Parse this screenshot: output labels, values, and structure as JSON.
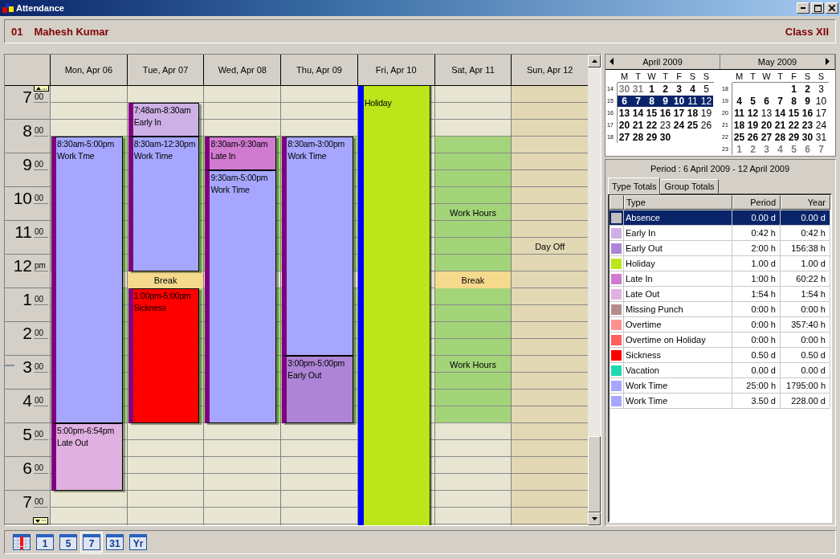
{
  "window": {
    "title": "Attendance"
  },
  "person": {
    "number": "01",
    "name": "Mahesh Kumar",
    "class": "Class XII"
  },
  "time_labels": [
    {
      "hour": "7",
      "suffix": "00"
    },
    {
      "hour": "8",
      "suffix": "00"
    },
    {
      "hour": "9",
      "suffix": "00"
    },
    {
      "hour": "10",
      "suffix": "00"
    },
    {
      "hour": "11",
      "suffix": "00"
    },
    {
      "hour": "12",
      "suffix": "pm"
    },
    {
      "hour": "1",
      "suffix": "00"
    },
    {
      "hour": "2",
      "suffix": "00"
    },
    {
      "hour": "3",
      "suffix": "00"
    },
    {
      "hour": "4",
      "suffix": "00"
    },
    {
      "hour": "5",
      "suffix": "00"
    },
    {
      "hour": "6",
      "suffix": "00"
    },
    {
      "hour": "7",
      "suffix": "00"
    }
  ],
  "days": [
    {
      "label": "Mon, Apr 06",
      "kind": "workday",
      "work_hours": true,
      "events": [
        {
          "kind": "timed",
          "time": "8:30am-5:00pm",
          "type": "Work Tme",
          "color": "#a6a6ff"
        },
        {
          "kind": "timed",
          "time": "5:00pm-6:54pm",
          "type": "Late Out",
          "color": "#e0b0e0"
        }
      ]
    },
    {
      "label": "Tue, Apr 07",
      "kind": "workday",
      "work_hours": true,
      "break_label": "Break",
      "events": [
        {
          "kind": "timed",
          "time": "7:48am-8:30am",
          "type": "Early In",
          "color": "#cdb0e6"
        },
        {
          "kind": "timed",
          "time": "8:30am-12:30pm",
          "type": "Work Time",
          "color": "#a6a6ff"
        },
        {
          "kind": "timed",
          "time": "1:00pm-5:00pm",
          "type": "Sickness",
          "color": "#ff0000"
        }
      ]
    },
    {
      "label": "Wed, Apr 08",
      "kind": "workday",
      "work_hours": true,
      "events": [
        {
          "kind": "timed",
          "time": "8:30am-9:30am",
          "type": "Late In",
          "color": "#d07ad0"
        },
        {
          "kind": "timed",
          "time": "9:30am-5:00pm",
          "type": "Work Time",
          "color": "#a6a6ff"
        }
      ]
    },
    {
      "label": "Thu, Apr 09",
      "kind": "workday",
      "work_hours": true,
      "events": [
        {
          "kind": "timed",
          "time": "8:30am-3:00pm",
          "type": "Work Time",
          "color": "#a6a6ff"
        },
        {
          "kind": "timed",
          "time": "3:00pm-5:00pm",
          "type": "Early Out",
          "color": "#ae84d6"
        }
      ]
    },
    {
      "label": "Fri, Apr 10",
      "kind": "workday",
      "events": [
        {
          "kind": "all_day",
          "type": "Holiday",
          "color": "#bce619"
        }
      ]
    },
    {
      "label": "Sat, Apr 11",
      "kind": "workday",
      "work_hours": true,
      "break_label": "Break",
      "hours_labels": [
        "Work Hours",
        "Work Hours"
      ]
    },
    {
      "label": "Sun, Apr 12",
      "kind": "day_off",
      "note": "Day Off"
    }
  ],
  "mini_calendar": {
    "months": [
      {
        "title": "April 2009",
        "weekdays": [
          "M",
          "T",
          "W",
          "T",
          "F",
          "S",
          "S"
        ],
        "weeks": [
          {
            "number": "14",
            "selected": false,
            "days": [
              {
                "day": "30",
                "kind": "other"
              },
              {
                "day": "31",
                "kind": "other"
              },
              {
                "day": "1",
                "kind": "busy"
              },
              {
                "day": "2",
                "kind": "busy"
              },
              {
                "day": "3",
                "kind": "busy"
              },
              {
                "day": "4",
                "kind": "busy"
              },
              {
                "day": "5",
                "kind": "plain"
              }
            ]
          },
          {
            "number": "15",
            "selected": true,
            "days": [
              {
                "day": "6",
                "kind": "busy"
              },
              {
                "day": "7",
                "kind": "busy"
              },
              {
                "day": "8",
                "kind": "busy"
              },
              {
                "day": "9",
                "kind": "busy"
              },
              {
                "day": "10",
                "kind": "busy"
              },
              {
                "day": "11",
                "kind": "plain"
              },
              {
                "day": "12",
                "kind": "plain"
              }
            ]
          },
          {
            "number": "16",
            "selected": false,
            "days": [
              {
                "day": "13",
                "kind": "busy"
              },
              {
                "day": "14",
                "kind": "busy"
              },
              {
                "day": "15",
                "kind": "busy"
              },
              {
                "day": "16",
                "kind": "busy"
              },
              {
                "day": "17",
                "kind": "busy"
              },
              {
                "day": "18",
                "kind": "busy"
              },
              {
                "day": "19",
                "kind": "plain"
              }
            ]
          },
          {
            "number": "17",
            "selected": false,
            "days": [
              {
                "day": "20",
                "kind": "busy"
              },
              {
                "day": "21",
                "kind": "busy"
              },
              {
                "day": "22",
                "kind": "busy"
              },
              {
                "day": "23",
                "kind": "plain"
              },
              {
                "day": "24",
                "kind": "busy"
              },
              {
                "day": "25",
                "kind": "busy"
              },
              {
                "day": "26",
                "kind": "plain"
              }
            ]
          },
          {
            "number": "18",
            "selected": false,
            "days": [
              {
                "day": "27",
                "kind": "busy"
              },
              {
                "day": "28",
                "kind": "busy"
              },
              {
                "day": "29",
                "kind": "busy"
              },
              {
                "day": "30",
                "kind": "busy"
              },
              {
                "kind": "blank"
              },
              {
                "kind": "blank"
              },
              {
                "kind": "blank"
              }
            ]
          }
        ]
      },
      {
        "title": "May 2009",
        "weekdays": [
          "M",
          "T",
          "W",
          "T",
          "F",
          "S",
          "S"
        ],
        "weeks": [
          {
            "number": "18",
            "selected": false,
            "days": [
              {
                "kind": "blank"
              },
              {
                "kind": "blank"
              },
              {
                "kind": "blank"
              },
              {
                "kind": "blank"
              },
              {
                "day": "1",
                "kind": "busy"
              },
              {
                "day": "2",
                "kind": "busy"
              },
              {
                "day": "3",
                "kind": "plain"
              }
            ]
          },
          {
            "number": "19",
            "selected": false,
            "days": [
              {
                "day": "4",
                "kind": "busy"
              },
              {
                "day": "5",
                "kind": "busy"
              },
              {
                "day": "6",
                "kind": "busy"
              },
              {
                "day": "7",
                "kind": "busy"
              },
              {
                "day": "8",
                "kind": "busy"
              },
              {
                "day": "9",
                "kind": "busy"
              },
              {
                "day": "10",
                "kind": "plain"
              }
            ]
          },
          {
            "number": "20",
            "selected": false,
            "days": [
              {
                "day": "11",
                "kind": "busy"
              },
              {
                "day": "12",
                "kind": "busy"
              },
              {
                "day": "13",
                "kind": "plain"
              },
              {
                "day": "14",
                "kind": "busy"
              },
              {
                "day": "15",
                "kind": "busy"
              },
              {
                "day": "16",
                "kind": "busy"
              },
              {
                "day": "17",
                "kind": "plain"
              }
            ]
          },
          {
            "number": "21",
            "selected": false,
            "days": [
              {
                "day": "18",
                "kind": "busy"
              },
              {
                "day": "19",
                "kind": "busy"
              },
              {
                "day": "20",
                "kind": "busy"
              },
              {
                "day": "21",
                "kind": "busy"
              },
              {
                "day": "22",
                "kind": "busy"
              },
              {
                "day": "23",
                "kind": "busy"
              },
              {
                "day": "24",
                "kind": "plain"
              }
            ]
          },
          {
            "number": "22",
            "selected": false,
            "days": [
              {
                "day": "25",
                "kind": "busy"
              },
              {
                "day": "26",
                "kind": "busy"
              },
              {
                "day": "27",
                "kind": "busy"
              },
              {
                "day": "28",
                "kind": "busy"
              },
              {
                "day": "29",
                "kind": "busy"
              },
              {
                "day": "30",
                "kind": "busy"
              },
              {
                "day": "31",
                "kind": "plain"
              }
            ]
          },
          {
            "number": "23",
            "selected": false,
            "days": [
              {
                "day": "1",
                "kind": "other"
              },
              {
                "day": "2",
                "kind": "other"
              },
              {
                "day": "3",
                "kind": "other"
              },
              {
                "day": "4",
                "kind": "other"
              },
              {
                "day": "5",
                "kind": "other"
              },
              {
                "day": "6",
                "kind": "other"
              },
              {
                "day": "7",
                "kind": "other"
              }
            ]
          }
        ]
      }
    ]
  },
  "period": "Period : 6 April 2009 - 12 April 2009",
  "tabs": [
    {
      "label": "Type Totals",
      "selected": true
    },
    {
      "label": "Group Totals",
      "selected": false
    }
  ],
  "table": {
    "columns": [
      "Type",
      "Period",
      "Year"
    ],
    "rows": [
      {
        "type": "Absence",
        "color": "#c0c0c0",
        "period": "0.00 d",
        "year": "0.00 d",
        "selected": true
      },
      {
        "type": "Early In",
        "color": "#cdb0e6",
        "period": "0:42 h",
        "year": "0:42 h",
        "selected": false
      },
      {
        "type": "Early Out",
        "color": "#ae84d6",
        "period": "2:00 h",
        "year": "156:38 h",
        "selected": false
      },
      {
        "type": "Holiday",
        "color": "#bce619",
        "period": "1.00 d",
        "year": "1.00 d",
        "selected": false
      },
      {
        "type": "Late In",
        "color": "#d07ad0",
        "period": "1:00 h",
        "year": "60:22 h",
        "selected": false
      },
      {
        "type": "Late Out",
        "color": "#e0b0e0",
        "period": "1:54 h",
        "year": "1:54 h",
        "selected": false
      },
      {
        "type": "Missing Punch",
        "color": "#b48c8c",
        "period": "0:00 h",
        "year": "0:00 h",
        "selected": false
      },
      {
        "type": "Overtime",
        "color": "#ff9090",
        "period": "0:00 h",
        "year": "357:40 h",
        "selected": false
      },
      {
        "type": "Overtime on Holiday",
        "color": "#ff6060",
        "period": "0:00 h",
        "year": "0:00 h",
        "selected": false
      },
      {
        "type": "Sickness",
        "color": "#ff0000",
        "period": "0.50 d",
        "year": "0.50 d",
        "selected": false
      },
      {
        "type": "Vacation",
        "color": "#1ed8b0",
        "period": "0.00 d",
        "year": "0.00 d",
        "selected": false
      },
      {
        "type": "Work Time",
        "color": "#a6a6ff",
        "period": "25:00 h",
        "year": "1795:00 h",
        "selected": false
      },
      {
        "type": "Work Time",
        "color": "#a6a6ff",
        "period": "3.50 d",
        "year": "228.00 d",
        "selected": false
      }
    ]
  },
  "toolbar": [
    {
      "kind": "alert",
      "selected": false
    },
    {
      "kind": "label",
      "label": "1",
      "selected": false
    },
    {
      "kind": "label",
      "label": "5",
      "selected": false
    },
    {
      "kind": "label",
      "label": "7",
      "selected": true
    },
    {
      "kind": "label",
      "label": "31",
      "selected": false
    },
    {
      "kind": "label",
      "label": "Yr",
      "selected": false
    }
  ]
}
